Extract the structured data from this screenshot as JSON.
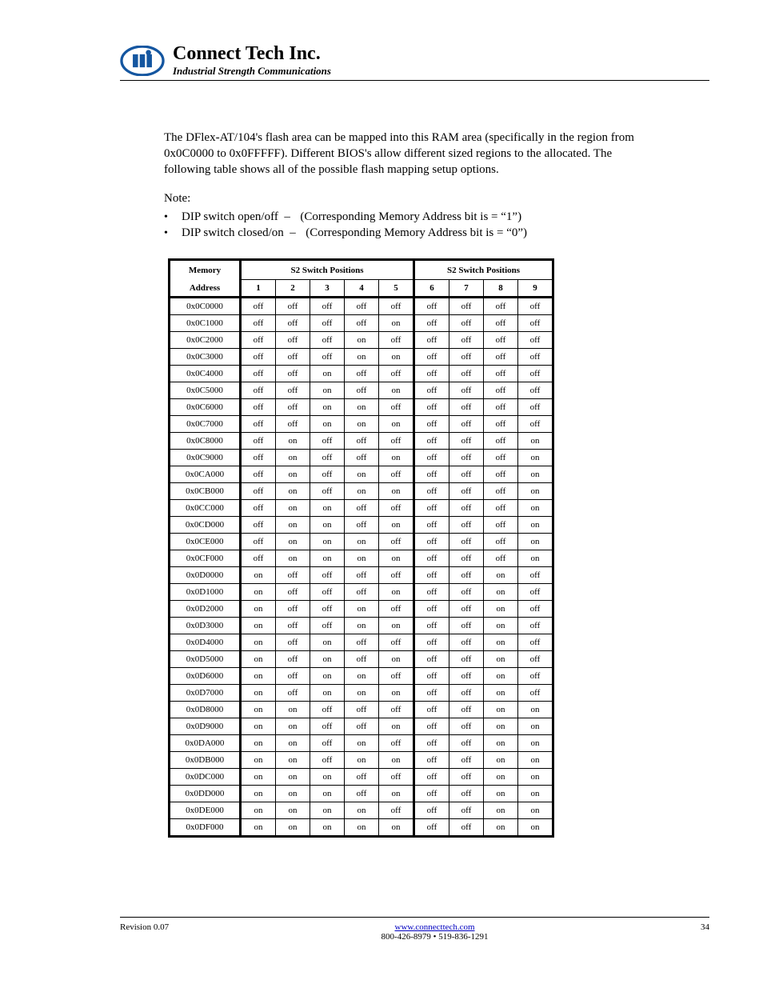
{
  "header": {
    "company": "Connect Tech Inc.",
    "tagline": "Industrial Strength Communications"
  },
  "body": {
    "sentence1": "The DFlex-AT/104's flash area can be mapped into this RAM area (specifically in the region from",
    "sentence2": "0x0C0000 to 0x0FFFFF). Different BIOS's allow different sized regions to the allocated. The",
    "sentence3": "following table shows all of the possible flash mapping setup options.",
    "note_header": "Note:",
    "note1_text": "(Corresponding Memory Address bit is = “1”)",
    "note1_label": "DIP switch open/off",
    "note2_label": "DIP switch closed/on",
    "note2_text": "(Corresponding Memory Address bit is = “0”)"
  },
  "table": {
    "header_addr": "Memory",
    "header_addr2": "Address",
    "header_s2a": "S2 Switch Positions",
    "header_s2b": "S2 Switch Positions",
    "posA": [
      "1",
      "2",
      "3",
      "4",
      "5"
    ],
    "posB": [
      "6",
      "7",
      "8",
      "9"
    ],
    "rows": [
      {
        "a": "0x0C0000",
        "s1": [
          "off",
          "off",
          "off",
          "off",
          "off"
        ],
        "s2": [
          "off",
          "off",
          "off",
          "off"
        ]
      },
      {
        "a": "0x0C1000",
        "s1": [
          "off",
          "off",
          "off",
          "off",
          "on"
        ],
        "s2": [
          "off",
          "off",
          "off",
          "off"
        ]
      },
      {
        "a": "0x0C2000",
        "s1": [
          "off",
          "off",
          "off",
          "on",
          "off"
        ],
        "s2": [
          "off",
          "off",
          "off",
          "off"
        ]
      },
      {
        "a": "0x0C3000",
        "s1": [
          "off",
          "off",
          "off",
          "on",
          "on"
        ],
        "s2": [
          "off",
          "off",
          "off",
          "off"
        ]
      },
      {
        "a": "0x0C4000",
        "s1": [
          "off",
          "off",
          "on",
          "off",
          "off"
        ],
        "s2": [
          "off",
          "off",
          "off",
          "off"
        ]
      },
      {
        "a": "0x0C5000",
        "s1": [
          "off",
          "off",
          "on",
          "off",
          "on"
        ],
        "s2": [
          "off",
          "off",
          "off",
          "off"
        ]
      },
      {
        "a": "0x0C6000",
        "s1": [
          "off",
          "off",
          "on",
          "on",
          "off"
        ],
        "s2": [
          "off",
          "off",
          "off",
          "off"
        ]
      },
      {
        "a": "0x0C7000",
        "s1": [
          "off",
          "off",
          "on",
          "on",
          "on"
        ],
        "s2": [
          "off",
          "off",
          "off",
          "off"
        ]
      },
      {
        "a": "0x0C8000",
        "s1": [
          "off",
          "on",
          "off",
          "off",
          "off"
        ],
        "s2": [
          "off",
          "off",
          "off",
          "on"
        ]
      },
      {
        "a": "0x0C9000",
        "s1": [
          "off",
          "on",
          "off",
          "off",
          "on"
        ],
        "s2": [
          "off",
          "off",
          "off",
          "on"
        ]
      },
      {
        "a": "0x0CA000",
        "s1": [
          "off",
          "on",
          "off",
          "on",
          "off"
        ],
        "s2": [
          "off",
          "off",
          "off",
          "on"
        ]
      },
      {
        "a": "0x0CB000",
        "s1": [
          "off",
          "on",
          "off",
          "on",
          "on"
        ],
        "s2": [
          "off",
          "off",
          "off",
          "on"
        ]
      },
      {
        "a": "0x0CC000",
        "s1": [
          "off",
          "on",
          "on",
          "off",
          "off"
        ],
        "s2": [
          "off",
          "off",
          "off",
          "on"
        ]
      },
      {
        "a": "0x0CD000",
        "s1": [
          "off",
          "on",
          "on",
          "off",
          "on"
        ],
        "s2": [
          "off",
          "off",
          "off",
          "on"
        ]
      },
      {
        "a": "0x0CE000",
        "s1": [
          "off",
          "on",
          "on",
          "on",
          "off"
        ],
        "s2": [
          "off",
          "off",
          "off",
          "on"
        ]
      },
      {
        "a": "0x0CF000",
        "s1": [
          "off",
          "on",
          "on",
          "on",
          "on"
        ],
        "s2": [
          "off",
          "off",
          "off",
          "on"
        ]
      },
      {
        "a": "0x0D0000",
        "s1": [
          "on",
          "off",
          "off",
          "off",
          "off"
        ],
        "s2": [
          "off",
          "off",
          "on",
          "off"
        ]
      },
      {
        "a": "0x0D1000",
        "s1": [
          "on",
          "off",
          "off",
          "off",
          "on"
        ],
        "s2": [
          "off",
          "off",
          "on",
          "off"
        ]
      },
      {
        "a": "0x0D2000",
        "s1": [
          "on",
          "off",
          "off",
          "on",
          "off"
        ],
        "s2": [
          "off",
          "off",
          "on",
          "off"
        ]
      },
      {
        "a": "0x0D3000",
        "s1": [
          "on",
          "off",
          "off",
          "on",
          "on"
        ],
        "s2": [
          "off",
          "off",
          "on",
          "off"
        ]
      },
      {
        "a": "0x0D4000",
        "s1": [
          "on",
          "off",
          "on",
          "off",
          "off"
        ],
        "s2": [
          "off",
          "off",
          "on",
          "off"
        ]
      },
      {
        "a": "0x0D5000",
        "s1": [
          "on",
          "off",
          "on",
          "off",
          "on"
        ],
        "s2": [
          "off",
          "off",
          "on",
          "off"
        ]
      },
      {
        "a": "0x0D6000",
        "s1": [
          "on",
          "off",
          "on",
          "on",
          "off"
        ],
        "s2": [
          "off",
          "off",
          "on",
          "off"
        ]
      },
      {
        "a": "0x0D7000",
        "s1": [
          "on",
          "off",
          "on",
          "on",
          "on"
        ],
        "s2": [
          "off",
          "off",
          "on",
          "off"
        ]
      },
      {
        "a": "0x0D8000",
        "s1": [
          "on",
          "on",
          "off",
          "off",
          "off"
        ],
        "s2": [
          "off",
          "off",
          "on",
          "on"
        ]
      },
      {
        "a": "0x0D9000",
        "s1": [
          "on",
          "on",
          "off",
          "off",
          "on"
        ],
        "s2": [
          "off",
          "off",
          "on",
          "on"
        ]
      },
      {
        "a": "0x0DA000",
        "s1": [
          "on",
          "on",
          "off",
          "on",
          "off"
        ],
        "s2": [
          "off",
          "off",
          "on",
          "on"
        ]
      },
      {
        "a": "0x0DB000",
        "s1": [
          "on",
          "on",
          "off",
          "on",
          "on"
        ],
        "s2": [
          "off",
          "off",
          "on",
          "on"
        ]
      },
      {
        "a": "0x0DC000",
        "s1": [
          "on",
          "on",
          "on",
          "off",
          "off"
        ],
        "s2": [
          "off",
          "off",
          "on",
          "on"
        ]
      },
      {
        "a": "0x0DD000",
        "s1": [
          "on",
          "on",
          "on",
          "off",
          "on"
        ],
        "s2": [
          "off",
          "off",
          "on",
          "on"
        ]
      },
      {
        "a": "0x0DE000",
        "s1": [
          "on",
          "on",
          "on",
          "on",
          "off"
        ],
        "s2": [
          "off",
          "off",
          "on",
          "on"
        ]
      },
      {
        "a": "0x0DF000",
        "s1": [
          "on",
          "on",
          "on",
          "on",
          "on"
        ],
        "s2": [
          "off",
          "off",
          "on",
          "on"
        ]
      }
    ]
  },
  "footer": {
    "left": "Revision 0.07",
    "mid_top": "www.connecttech.com",
    "mid_bottom": "800-426-8979 • 519-836-1291",
    "right": "34"
  }
}
